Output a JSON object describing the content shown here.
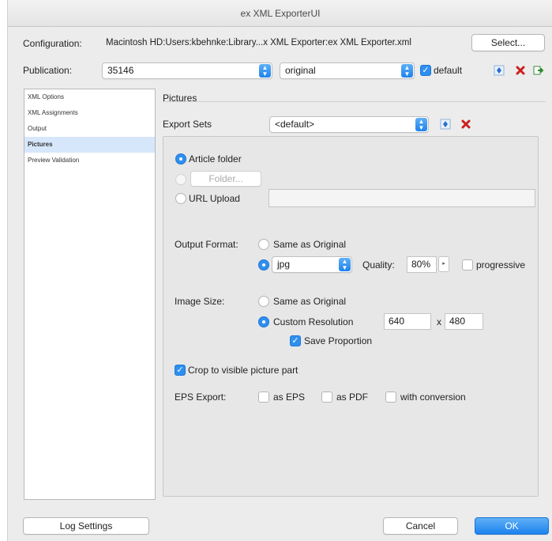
{
  "window": {
    "title": "ex XML ExporterUI"
  },
  "configuration": {
    "label": "Configuration:",
    "path": "Macintosh HD:Users:kbehnke:Library...x XML Exporter:ex XML Exporter.xml",
    "select_button": "Select..."
  },
  "publication": {
    "label": "Publication:",
    "id_value": "35146",
    "version_value": "original",
    "default_label": "default"
  },
  "sidebar": {
    "items": [
      {
        "label": "XML Options"
      },
      {
        "label": "XML Assignments"
      },
      {
        "label": "Output"
      },
      {
        "label": "Pictures"
      },
      {
        "label": "Preview Validation"
      }
    ]
  },
  "main": {
    "section_title": "Pictures",
    "export_sets_label": "Export Sets",
    "export_sets_value": "<default>",
    "article_folder": "Article folder",
    "folder_button": "Folder...",
    "url_upload": "URL Upload",
    "output_format_label": "Output Format:",
    "same_as_original_1": "Same as Original",
    "format_value": "jpg",
    "quality_label": "Quality:",
    "quality_value": "80%",
    "progressive": "progressive",
    "image_size_label": "Image Size:",
    "same_as_original_2": "Same as Original",
    "custom_resolution": "Custom Resolution",
    "width_value": "640",
    "by": "x",
    "height_value": "480",
    "save_proportion": "Save Proportion",
    "crop_label": "Crop to visible picture part",
    "eps_export_label": "EPS Export:",
    "as_eps": "as EPS",
    "as_pdf": "as PDF",
    "with_conversion": "with conversion"
  },
  "footer": {
    "log_settings": "Log Settings",
    "cancel": "Cancel",
    "ok": "OK"
  },
  "colors": {
    "accent": "#2f8ff0",
    "selection": "#d6e7fb",
    "delete": "#cc1f1f"
  }
}
